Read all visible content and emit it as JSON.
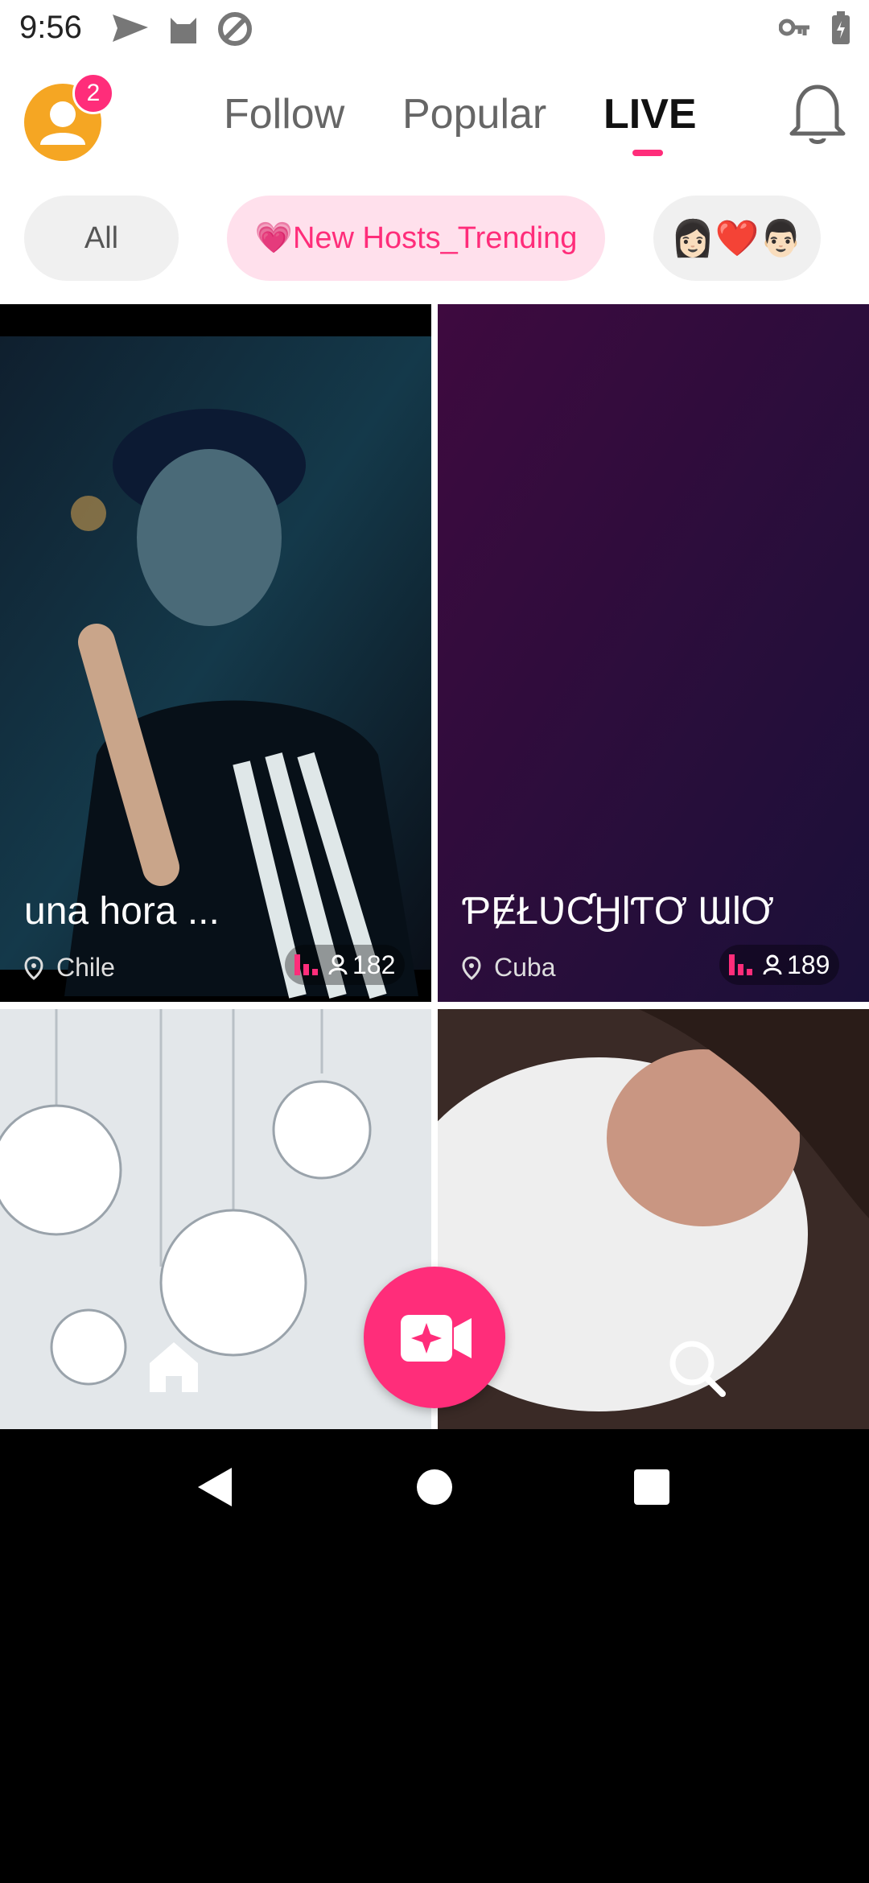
{
  "status_bar": {
    "time": "9:56",
    "icons": [
      "send-icon",
      "cat-icon",
      "at-icon"
    ],
    "right_icons": [
      "key-icon",
      "battery-icon"
    ]
  },
  "header": {
    "avatar_badge": "2",
    "tabs": [
      {
        "label": "Follow"
      },
      {
        "label": "Popular"
      },
      {
        "label": "LIVE"
      }
    ]
  },
  "chips": [
    {
      "label": "All"
    },
    {
      "label": "💗New Hosts_Trending"
    },
    {
      "label": "👩🏻❤️👨🏻"
    }
  ],
  "cards": [
    {
      "title": "una hora ...",
      "country": "Chile",
      "viewers": "182"
    },
    {
      "title": "ƤɆŁƲƇӇƖƬƠ ƜƖƠ",
      "country": "Cuba",
      "viewers": "189"
    },
    {
      "title": "",
      "country": "",
      "viewers": ""
    },
    {
      "title": "",
      "country": "",
      "viewers": ""
    }
  ],
  "colors": {
    "accent": "#ff2d7a",
    "avatar": "#f5a623"
  }
}
